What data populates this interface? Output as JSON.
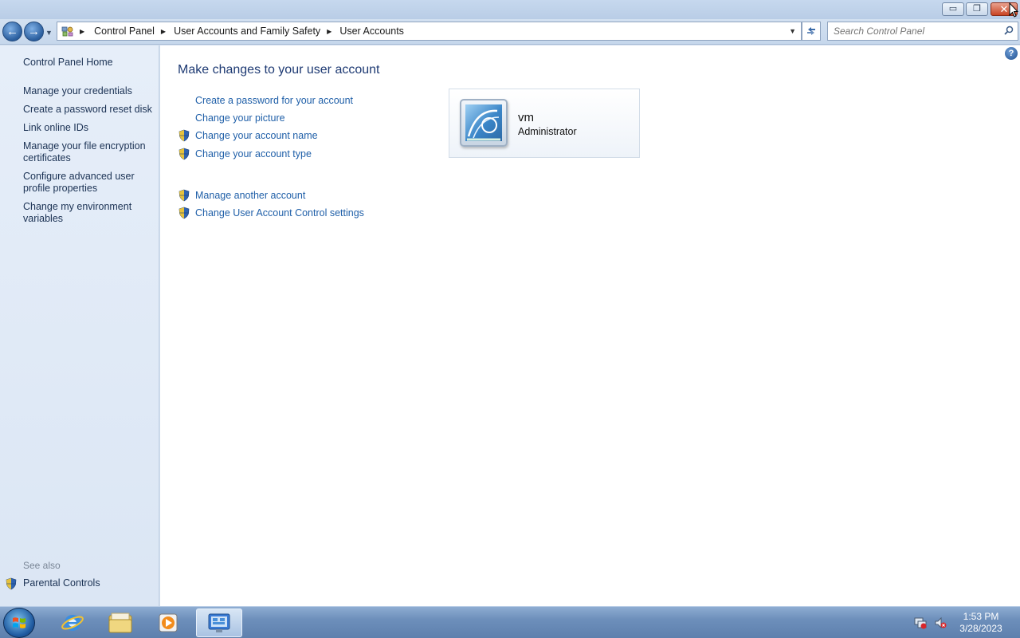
{
  "window": {
    "minimize_label": "▭",
    "restore_label": "❐",
    "close_label": "✕"
  },
  "navbar": {
    "back_label": "←",
    "forward_label": "→",
    "breadcrumbs": [
      "Control Panel",
      "User Accounts and Family Safety",
      "User Accounts"
    ],
    "search_placeholder": "Search Control Panel"
  },
  "sidebar": {
    "home": "Control Panel Home",
    "links": [
      "Manage your credentials",
      "Create a password reset disk",
      "Link online IDs",
      "Manage your file encryption certificates",
      "Configure advanced user profile properties",
      "Change my environment variables"
    ],
    "see_also": "See also",
    "parental_controls": "Parental Controls"
  },
  "main": {
    "heading": "Make changes to your user account",
    "tasks": [
      {
        "label": "Create a password for your account",
        "shield": false
      },
      {
        "label": "Change your picture",
        "shield": false
      },
      {
        "label": "Change your account name",
        "shield": true
      },
      {
        "label": "Change your account type",
        "shield": true
      }
    ],
    "other_tasks": [
      {
        "label": "Manage another account",
        "shield": true
      },
      {
        "label": "Change User Account Control settings",
        "shield": true
      }
    ],
    "user": {
      "name": "vm",
      "role": "Administrator"
    },
    "help_label": "?"
  },
  "taskbar": {
    "items": [
      "start-button",
      "internet-explorer",
      "windows-explorer",
      "media-player",
      "control-panel"
    ],
    "time": "1:53 PM",
    "date": "3/28/2023"
  },
  "colors": {
    "link": "#1f5fa8",
    "heading": "#1e3a73",
    "sidebar_bg": "#e3ecf7",
    "close_button": "#c84322"
  }
}
